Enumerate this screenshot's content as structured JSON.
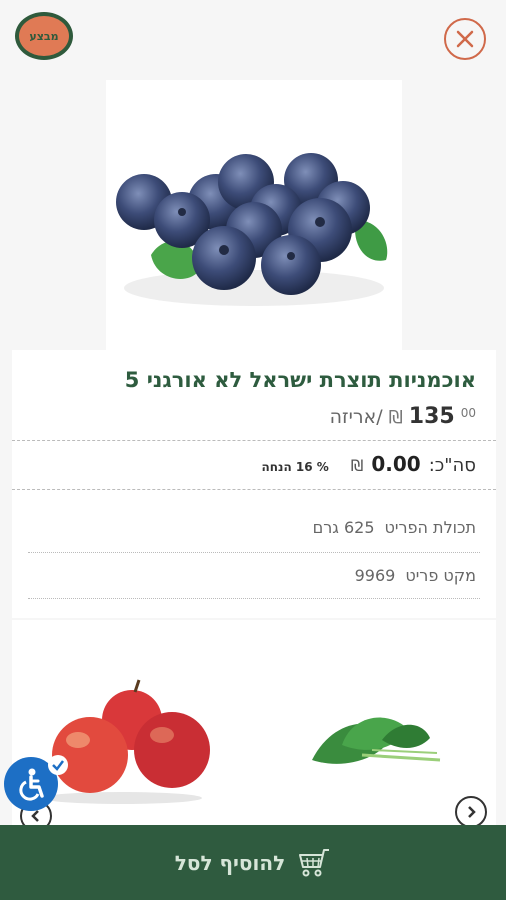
{
  "header": {
    "sale_badge": "מבצע",
    "close_icon": "close-icon"
  },
  "product": {
    "title": "אוכמניות תוצרת ישראל לא אורגני 5",
    "price_integer": "135",
    "price_decimal": "00",
    "currency": "₪",
    "unit": "/אריזה",
    "total_label": "סה\"כ:",
    "total_value": "0.00",
    "total_currency": "₪",
    "discount": "% 16 הנחה",
    "weight_label": "תכולת הפריט",
    "weight_value": "625 גרם",
    "sku_label": "מקט פריט",
    "sku_value": "9969"
  },
  "cart": {
    "add_label": "להוסיף לסל",
    "icon": "cart-icon"
  },
  "colors": {
    "brand_green": "#2f5b3f",
    "accent_orange": "#e07a55",
    "accessibility_blue": "#1d6fc5"
  }
}
